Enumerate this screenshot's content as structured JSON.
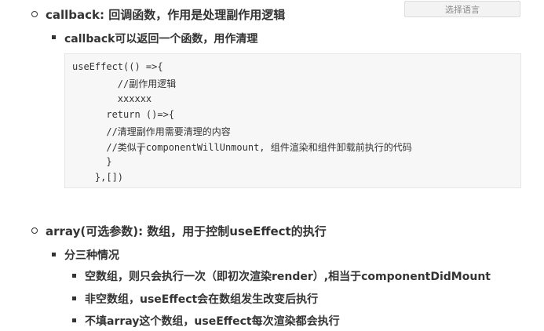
{
  "lang_select_label": "选择语言",
  "sections": {
    "callback_item": "callback: 回调函数，作用是处理副作用逻辑",
    "callback_sub": "callback可以返回一个函数，用作清理",
    "code_lines": [
      "useEffect(() =>{",
      "        //副作用逻辑",
      "        xxxxxx",
      "      return ()=>{",
      "      //清理副作用需要清理的内容",
      "      //类似于componentWillUnmount, 组件渲染和组件卸载前执行的代码",
      "      }",
      "    },[])"
    ],
    "array_item": "array(可选参数): 数组，用于控制useEffect的执行",
    "array_sub": "分三种情况",
    "array_cases": [
      "空数组，则只会执行一次（即初次渲染render）,相当于componentDidMount",
      "非空数组，useEffect会在数组发生改变后执行",
      "不填array这个数组，useEffect每次渲染都会执行"
    ]
  },
  "cursor_glyph": "I"
}
